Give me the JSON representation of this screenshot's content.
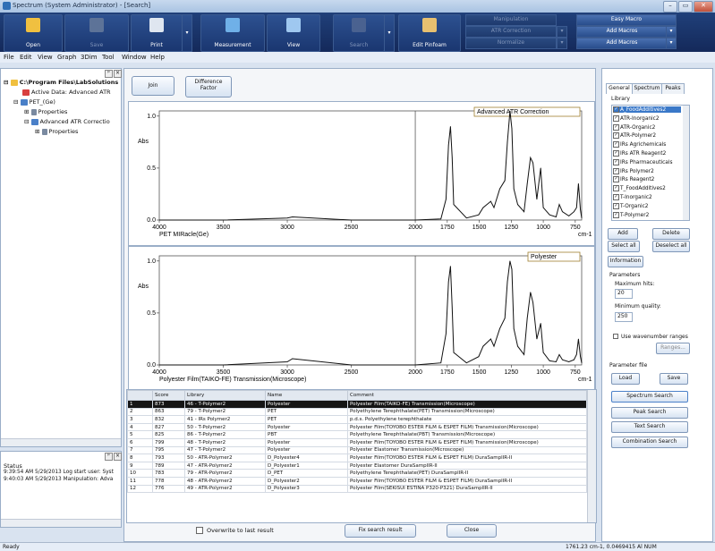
{
  "window": {
    "title": "Spectrum (System Administrator) - [Search]",
    "min": "–",
    "max": "▭",
    "close": "✕"
  },
  "ribbon": {
    "open": "Open",
    "save": "Save",
    "print": "Print",
    "measurement": "Measurement",
    "view": "View",
    "search": "Search",
    "edit_pinfoam": "Edit Pinfoam",
    "manipulation": "Manipulation",
    "atr_correction": "ATR Correction",
    "normalize": "Normalize",
    "easy_macro": "Easy Macro",
    "add_macros_1": "Add Macros",
    "add_macros_2": "Add Macros",
    "dropdown": "▾"
  },
  "menu": [
    "File",
    "Edit",
    "View",
    "Graph",
    "3Dim",
    "Tool",
    "Window",
    "Help"
  ],
  "tree": {
    "root": "C:\\Program Files\\LabSolutions",
    "active": "Active Data: Advanced ATR",
    "pet": "PET_(Ge)",
    "properties_1": "Properties",
    "atr": "Advanced ATR Correctio",
    "properties_2": "Properties",
    "expand": "⊟",
    "collapse": "⊞"
  },
  "status_panel": {
    "label": "Status",
    "lines": [
      "9:39:54 AM 5/29/2013 Log start user: Syst",
      "9:40:03 AM 5/29/2013 Manipulation: Adva"
    ]
  },
  "top_buttons": {
    "join": "Join",
    "difference_1": "Difference",
    "difference_2": "Factor"
  },
  "chart_data": [
    {
      "type": "line",
      "title": "Advanced ATR Correction",
      "xlabel": "PET MIRacle(Ge)",
      "ylabel": "Abs",
      "xunit": "cm-1",
      "xlim": [
        4000,
        700
      ],
      "ylim": [
        0,
        1.05
      ],
      "xticks": [
        "4000",
        "3500",
        "3000",
        "2500",
        "2000",
        "1750",
        "1500",
        "1250",
        "1000",
        "750"
      ],
      "yticks": [
        "0.0",
        "0.5",
        "1.0"
      ],
      "x": [
        4000,
        3500,
        3000,
        2960,
        2500,
        2000,
        1800,
        1760,
        1740,
        1725,
        1712,
        1700,
        1600,
        1505,
        1470,
        1410,
        1385,
        1340,
        1300,
        1280,
        1260,
        1245,
        1230,
        1200,
        1150,
        1125,
        1100,
        1080,
        1050,
        1020,
        1000,
        950,
        900,
        875,
        850,
        800,
        760,
        740,
        725,
        710,
        700
      ],
      "y": [
        0.0,
        0.0,
        0.02,
        0.03,
        0.0,
        0.0,
        0.01,
        0.2,
        0.72,
        0.9,
        0.6,
        0.15,
        0.02,
        0.05,
        0.12,
        0.18,
        0.12,
        0.3,
        0.38,
        0.75,
        1.05,
        0.88,
        0.3,
        0.15,
        0.08,
        0.35,
        0.6,
        0.55,
        0.2,
        0.5,
        0.12,
        0.05,
        0.03,
        0.15,
        0.08,
        0.04,
        0.08,
        0.12,
        0.35,
        0.1,
        0.02
      ]
    },
    {
      "type": "line",
      "title": "Polyester",
      "xlabel": "Polyester Film(TAIKO-FE) Transmission(Microscope)",
      "ylabel": "Abs",
      "xunit": "cm-1",
      "xlim": [
        4000,
        700
      ],
      "ylim": [
        0,
        1.05
      ],
      "xticks": [
        "4000",
        "3500",
        "3000",
        "2500",
        "2000",
        "1750",
        "1500",
        "1250",
        "1000",
        "750"
      ],
      "yticks": [
        "0.0",
        "0.5",
        "1.0"
      ],
      "x": [
        4000,
        3500,
        3000,
        2960,
        2500,
        2000,
        1800,
        1760,
        1740,
        1725,
        1712,
        1700,
        1600,
        1505,
        1470,
        1410,
        1385,
        1340,
        1300,
        1280,
        1260,
        1245,
        1230,
        1200,
        1150,
        1125,
        1100,
        1080,
        1050,
        1020,
        1000,
        950,
        900,
        875,
        850,
        800,
        760,
        740,
        725,
        710,
        700
      ],
      "y": [
        0.0,
        0.0,
        0.03,
        0.06,
        0.0,
        0.0,
        0.02,
        0.3,
        0.8,
        0.95,
        0.55,
        0.12,
        0.02,
        0.08,
        0.18,
        0.25,
        0.18,
        0.35,
        0.45,
        0.8,
        1.0,
        0.92,
        0.35,
        0.18,
        0.1,
        0.45,
        0.7,
        0.6,
        0.25,
        0.4,
        0.12,
        0.04,
        0.03,
        0.1,
        0.05,
        0.03,
        0.05,
        0.1,
        0.25,
        0.08,
        0.02
      ]
    }
  ],
  "results": {
    "headers": [
      "",
      "Score",
      "Library",
      "Name",
      "Comment"
    ],
    "rows": [
      [
        "1",
        "873",
        "46 - T-Polymer2",
        "Polyester",
        "Polyester Film(TAIKO-FE) Transmission(Microscope)"
      ],
      [
        "2",
        "863",
        "79 - T-Polymer2",
        "PET",
        "Polyethylene Terephthalate(PET) Transmission(Microscope)"
      ],
      [
        "3",
        "832",
        "41 - IRs Polymer2",
        "PET",
        "p.d.s. Polyethylene terephthalate"
      ],
      [
        "4",
        "827",
        "50 - T-Polymer2",
        "Polyester",
        "Polyester Film(TOYOBO ESTER FILM & ESPET FILM) Transmission(Microscope)"
      ],
      [
        "5",
        "825",
        "86 - T-Polymer2",
        "PBT",
        "Polyethylene Terephthalate(PBT) Transmission(Microscope)"
      ],
      [
        "6",
        "799",
        "48 - T-Polymer2",
        "Polyester",
        "Polyester Film(TOYOBO ESTER FILM & ESPET FILM) Transmission(Microscope)"
      ],
      [
        "7",
        "795",
        "47 - T-Polymer2",
        "Polyester",
        "Polyester Elastomer Transmission(Microscope)"
      ],
      [
        "8",
        "793",
        "50 - ATR-Polymer2",
        "D_Polyester4",
        "Polyester Film(TOYOBO ESTER FILM & ESPET FILM) DuraSamplIR-II"
      ],
      [
        "9",
        "789",
        "47 - ATR-Polymer2",
        "D_Polyester1",
        "Polyester Elastomer DuraSamplIR-II"
      ],
      [
        "10",
        "783",
        "79 - ATR-Polymer2",
        "D_PET",
        "Polyethylene Terephthalate(PET) DuraSamplIR-II"
      ],
      [
        "11",
        "778",
        "48 - ATR-Polymer2",
        "D_Polyester2",
        "Polyester Film(TOYOBO ESTER FILM & ESPET FILM) DuraSamplIR-II"
      ],
      [
        "12",
        "776",
        "49 - ATR-Polymer2",
        "D_Polyester3",
        "Polyester Film(SEKISUI ESTINA P320-P321) DuraSamplIR-II"
      ]
    ]
  },
  "bottom": {
    "overwrite": "Overwrite to last result",
    "fix": "Fix search result",
    "close": "Close"
  },
  "right": {
    "tabs": [
      "General",
      "Spectrum",
      "Peaks"
    ],
    "library_label": "Library",
    "libraries": [
      "A_FoodAdditives2",
      "ATR-Inorganic2",
      "ATR-Organic2",
      "ATR-Polymer2",
      "IRs Agrichemicals",
      "IRs ATR Reagent2",
      "IRs Pharmaceuticals",
      "IRs Polymer2",
      "IRs Reagent2",
      "T_FoodAdditives2",
      "T-Inorganic2",
      "T-Organic2",
      "T-Polymer2"
    ],
    "add": "Add",
    "delete": "Delete",
    "select_all": "Select all",
    "deselect_all": "Deselect all",
    "information": "Information",
    "parameters": "Parameters",
    "max_hits_label": "Maximum hits:",
    "max_hits": "20",
    "min_quality_label": "Minimum quality:",
    "min_quality": "250",
    "use_wavenumber": "Use wavenumber ranges",
    "ranges": "Ranges...",
    "param_file": "Parameter file",
    "load": "Load",
    "save": "Save",
    "spectrum_search": "Spectrum Search",
    "peak_search": "Peak Search",
    "text_search": "Text Search",
    "combination_search": "Combination Search"
  },
  "statusbar": {
    "left": "Ready",
    "right": "1761.23 cm-1, 0.0469415 Al     NUM"
  },
  "colors": {
    "ribbon": "#1a3670",
    "selection": "#151515",
    "accent": "#2f6fb6"
  }
}
